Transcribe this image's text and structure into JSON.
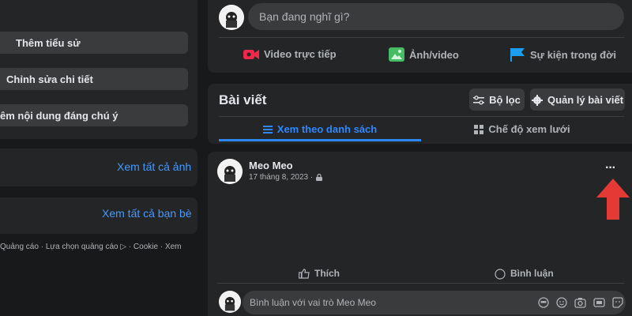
{
  "left": {
    "add_bio": "Thêm tiểu sử",
    "edit_details": "Chỉnh sửa chi tiết",
    "add_featured": "êm nội dung đáng chú ý",
    "see_all_photos": "Xem tất cả ảnh",
    "see_all_friends": "Xem tất cả bạn bè",
    "footer": "Quảng cáo · Lựa chọn quảng cáo ▷ · Cookie · Xem"
  },
  "composer": {
    "placeholder": "Bạn đang nghĩ gì?",
    "live_video": "Video trực tiếp",
    "photo_video": "Ảnh/video",
    "life_event": "Sự kiện trong đời"
  },
  "posts_panel": {
    "title": "Bài viết",
    "filter": "Bộ lọc",
    "manage": "Quản lý bài viết",
    "tab_list": "Xem theo danh sách",
    "tab_grid": "Chế độ xem lưới"
  },
  "post": {
    "author": "Meo Meo",
    "date": "17 tháng 8, 2023 ·",
    "more": "···",
    "like": "Thích",
    "comment": "Bình luận",
    "comment_placeholder": "Bình luận với vai trò Meo Meo"
  },
  "colors": {
    "accent": "#2d88ff",
    "arrow": "#e53935",
    "live": "#f02849",
    "photo": "#45bd62",
    "event": "#1b9df0"
  }
}
